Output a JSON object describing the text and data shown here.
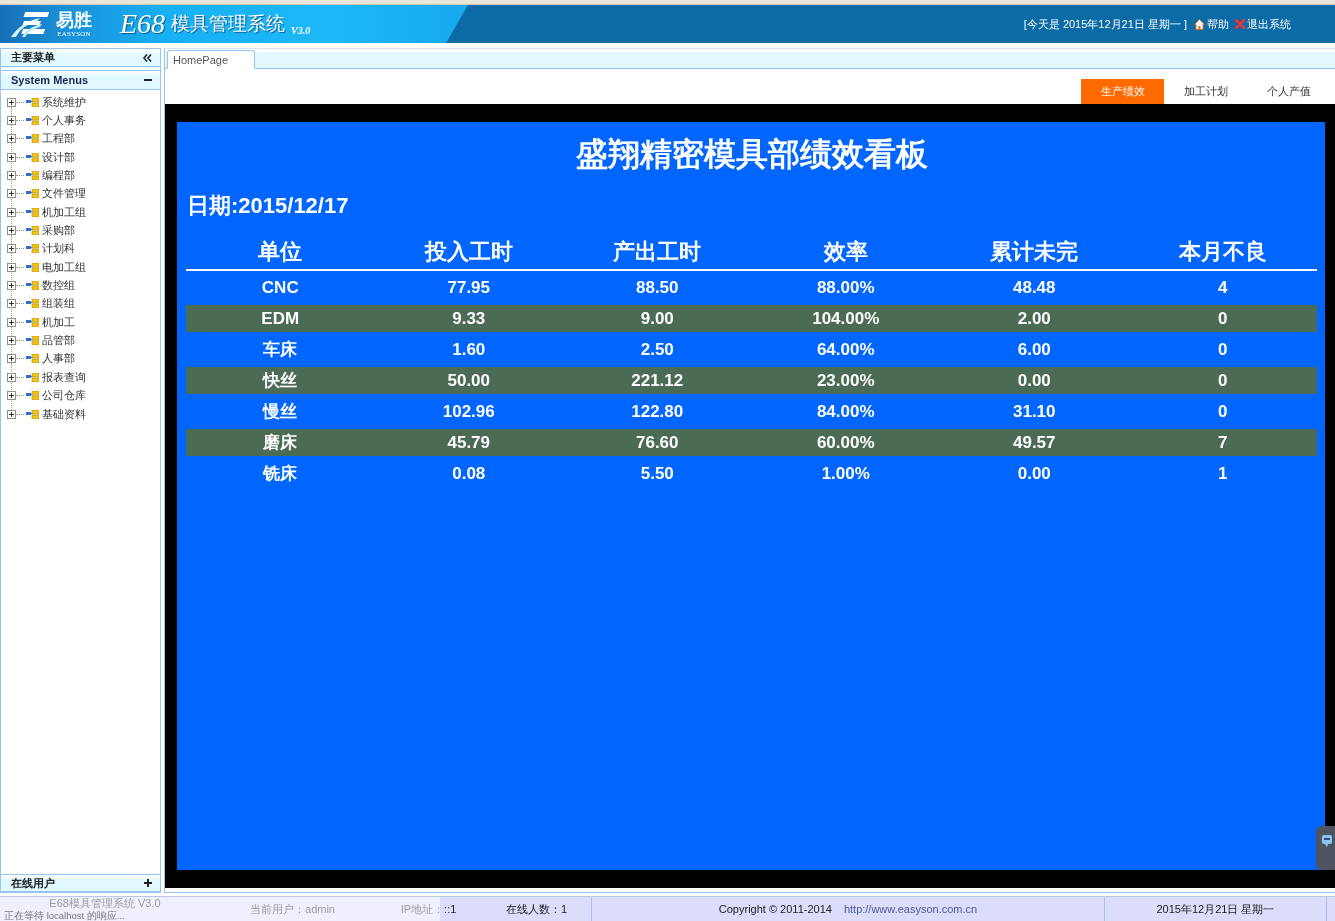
{
  "header": {
    "logo_cn": "易胜",
    "logo_en": "EASYSON",
    "product_code": "E68",
    "title": "模具管理系统",
    "version": "V3.0",
    "today": "[今天是 2015年12月21日 星期一 ]",
    "links": [
      {
        "kind": "help",
        "label": "帮助"
      },
      {
        "kind": "logout",
        "label": "退出系统"
      }
    ]
  },
  "sidebar": {
    "title": "主要菜单",
    "menu_panel": {
      "title": "System Menus",
      "expanded": true,
      "items": [
        {
          "label": "系统维护",
          "expanded": false
        },
        {
          "label": "个人事务",
          "expanded": false
        },
        {
          "label": "工程部",
          "expanded": false
        },
        {
          "label": "设计部",
          "expanded": false
        },
        {
          "label": "编程部",
          "expanded": false
        },
        {
          "label": "文件管理",
          "expanded": false
        },
        {
          "label": "机加工组",
          "expanded": false
        },
        {
          "label": "采购部",
          "expanded": false
        },
        {
          "label": "计划科",
          "expanded": false
        },
        {
          "label": "电加工组",
          "expanded": false
        },
        {
          "label": "数控组",
          "expanded": false
        },
        {
          "label": "组装组",
          "expanded": false
        },
        {
          "label": "机加工",
          "expanded": false
        },
        {
          "label": "品管部",
          "expanded": false
        },
        {
          "label": "人事部",
          "expanded": false
        },
        {
          "label": "报表查询",
          "expanded": false
        },
        {
          "label": "公司仓库",
          "expanded": false
        },
        {
          "label": "基础资料",
          "expanded": false
        }
      ]
    },
    "bottom_panel": {
      "title": "在线用户",
      "expanded": false
    }
  },
  "tabs": [
    {
      "label": "HomePage",
      "selected": true
    }
  ],
  "view_buttons": [
    {
      "label": "生产绩效",
      "selected": true
    },
    {
      "label": "加工计划",
      "selected": false
    },
    {
      "label": "个人产值",
      "selected": false
    }
  ],
  "board": {
    "title": "盛翔精密模具部绩效看板",
    "date": "日期:2015/12/17",
    "table": {
      "columns": [
        "单位",
        "投入工时",
        "产出工时",
        "效率",
        "累计未完",
        "本月不良"
      ],
      "rows": [
        [
          "CNC",
          "77.95",
          "88.50",
          "88.00%",
          "48.48",
          "4"
        ],
        [
          "EDM",
          "9.33",
          "9.00",
          "104.00%",
          "2.00",
          "0"
        ],
        [
          "车床",
          "1.60",
          "2.50",
          "64.00%",
          "6.00",
          "0"
        ],
        [
          "快丝",
          "50.00",
          "221.12",
          "23.00%",
          "0.00",
          "0"
        ],
        [
          "慢丝",
          "102.96",
          "122.80",
          "84.00%",
          "31.10",
          "0"
        ],
        [
          "磨床",
          "45.79",
          "76.60",
          "60.00%",
          "49.57",
          "7"
        ],
        [
          "铣床",
          "0.08",
          "5.50",
          "1.00%",
          "0.00",
          "1"
        ]
      ]
    }
  },
  "status_bar": {
    "fields": [
      "E68模具管理系统 V3.0",
      "当前用户：admin",
      "IP地址：::1",
      "在线人数：1"
    ],
    "copyright": "Copyright © 2011-2014",
    "link": "http://www.easyson.com.cn",
    "date": "2015年12月21日 星期一"
  },
  "browser_status": "正在等待 localhost 的响应..."
}
